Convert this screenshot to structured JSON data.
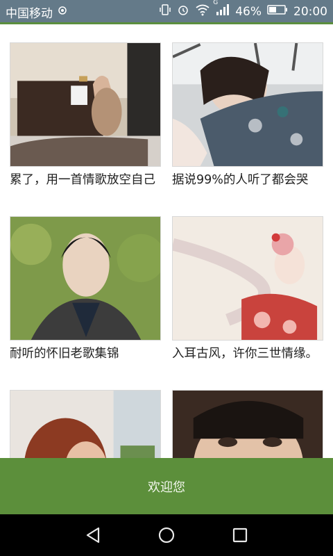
{
  "status_bar": {
    "carrier": "中国移动",
    "signal_label": "G",
    "battery": "46%",
    "time": "20:00",
    "icons": [
      "hotspot-icon",
      "vibrate-icon",
      "alarm-icon",
      "wifi-icon",
      "signal-icon",
      "battery-icon"
    ]
  },
  "playlists": [
    {
      "title": "累了，用一首情歌放空自己",
      "image": "woman-playing-piano-photo"
    },
    {
      "title": "据说99%的人听了都会哭",
      "image": "woman-lying-hand-on-forehead-photo"
    },
    {
      "title": "耐听的怀旧老歌集锦",
      "image": "woman-eyes-closed-portrait-photo"
    },
    {
      "title": "入耳古风，许你三世情缘。",
      "image": "anime-geisha-illustration"
    },
    {
      "title": "",
      "image": "red-haired-woman-photo"
    },
    {
      "title": "",
      "image": "woman-close-up-portrait-photo"
    }
  ],
  "welcome_button": "欢迎您",
  "nav": {
    "back": "back-icon",
    "home": "home-icon",
    "recents": "recents-icon"
  },
  "colors": {
    "accent_green": "#5c8f3b",
    "status_bar": "#647a89"
  }
}
